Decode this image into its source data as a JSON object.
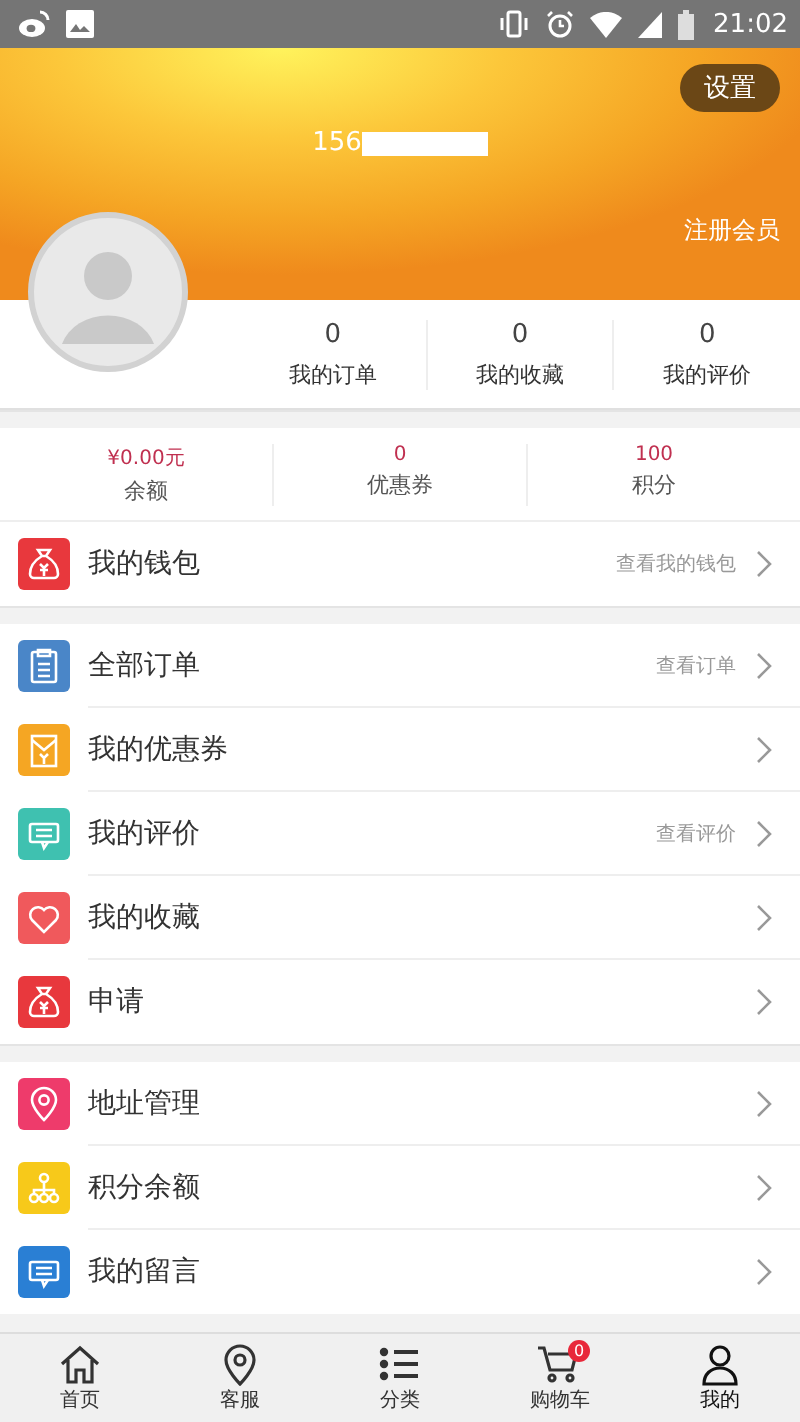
{
  "status_bar": {
    "time": "21:02"
  },
  "header": {
    "settings_button": "设置",
    "phone": "156",
    "register_link": "注册会员"
  },
  "stats": [
    {
      "value": "0",
      "label": "我的订单"
    },
    {
      "value": "0",
      "label": "我的收藏"
    },
    {
      "value": "0",
      "label": "我的评价"
    }
  ],
  "account": [
    {
      "value": "¥0.00元",
      "label": "余额"
    },
    {
      "value": "0",
      "label": "优惠券"
    },
    {
      "value": "100",
      "label": "积分"
    }
  ],
  "menu_groups": [
    [
      {
        "label": "我的钱包",
        "hint": "查看我的钱包",
        "kind": "bag",
        "color": "#e8383d"
      }
    ],
    [
      {
        "label": "全部订单",
        "hint": "查看订单",
        "kind": "clipboard",
        "color": "#4a86c8"
      },
      {
        "label": "我的优惠券",
        "kind": "envelope",
        "color": "#f5a623"
      },
      {
        "label": "我的评价",
        "hint": "查看评价",
        "kind": "chat",
        "color": "#3fc1b0"
      },
      {
        "label": "我的收藏",
        "kind": "heart",
        "color": "#f0595c"
      },
      {
        "label": "申请",
        "kind": "bag",
        "color": "#e8383d"
      }
    ],
    [
      {
        "label": "地址管理",
        "kind": "pin",
        "color": "#ee3b6b"
      },
      {
        "label": "积分余额",
        "kind": "network",
        "color": "#f7c91a"
      },
      {
        "label": "我的留言",
        "kind": "chat",
        "color": "#2a7fd4"
      }
    ]
  ],
  "tab_bar": [
    {
      "label": "首页",
      "kind": "home",
      "selected": false
    },
    {
      "label": "客服",
      "kind": "pin",
      "selected": false
    },
    {
      "label": "分类",
      "kind": "list",
      "selected": false
    },
    {
      "label": "购物车",
      "kind": "cart",
      "badge": "0",
      "selected": false
    },
    {
      "label": "我的",
      "kind": "person",
      "selected": true
    }
  ]
}
